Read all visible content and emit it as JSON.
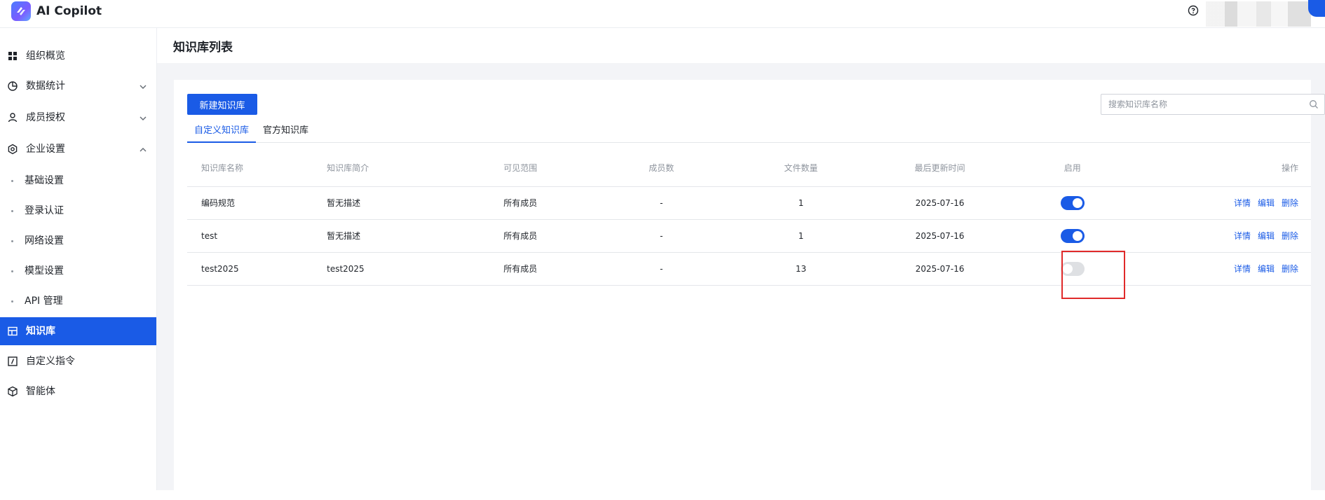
{
  "app": {
    "title": "AI Copilot"
  },
  "sidebar": {
    "items": [
      {
        "label": "组织概览",
        "icon": "grid-icon"
      },
      {
        "label": "数据统计",
        "icon": "pie-chart-icon"
      },
      {
        "label": "成员授权",
        "icon": "user-icon"
      },
      {
        "label": "企业设置",
        "icon": "settings-icon"
      },
      {
        "label": "知识库",
        "icon": "database-icon"
      },
      {
        "label": "自定义指令",
        "icon": "slash-command-icon"
      },
      {
        "label": "智能体",
        "icon": "cube-icon"
      }
    ],
    "sub_items": [
      {
        "label": "基础设置"
      },
      {
        "label": "登录认证"
      },
      {
        "label": "网络设置"
      },
      {
        "label": "模型设置"
      },
      {
        "label": "API 管理"
      }
    ]
  },
  "page": {
    "title": "知识库列表"
  },
  "toolbar": {
    "new_button": "新建知识库",
    "search_placeholder": "搜索知识库名称"
  },
  "tabs": [
    {
      "label": "自定义知识库",
      "active": true
    },
    {
      "label": "官方知识库",
      "active": false
    }
  ],
  "table": {
    "headers": {
      "name": "知识库名称",
      "desc": "知识库简介",
      "scope": "可见范围",
      "members": "成员数",
      "files": "文件数量",
      "updated": "最后更新时间",
      "enabled": "启用",
      "ops": "操作"
    },
    "rows": [
      {
        "name": "编码规范",
        "desc": "暂无描述",
        "scope": "所有成员",
        "members": "-",
        "files": "1",
        "updated": "2025-07-16",
        "enabled": true
      },
      {
        "name": "test",
        "desc": "暂无描述",
        "scope": "所有成员",
        "members": "-",
        "files": "1",
        "updated": "2025-07-16",
        "enabled": true
      },
      {
        "name": "test2025",
        "desc": "test2025",
        "scope": "所有成员",
        "members": "-",
        "files": "13",
        "updated": "2025-07-16",
        "enabled": false
      }
    ],
    "ops": {
      "detail": "详情",
      "edit": "编辑",
      "delete": "删除"
    }
  },
  "colors": {
    "accent": "#1a5be6",
    "highlight": "#e02a2a",
    "toggle_off": "#dee0e3"
  }
}
